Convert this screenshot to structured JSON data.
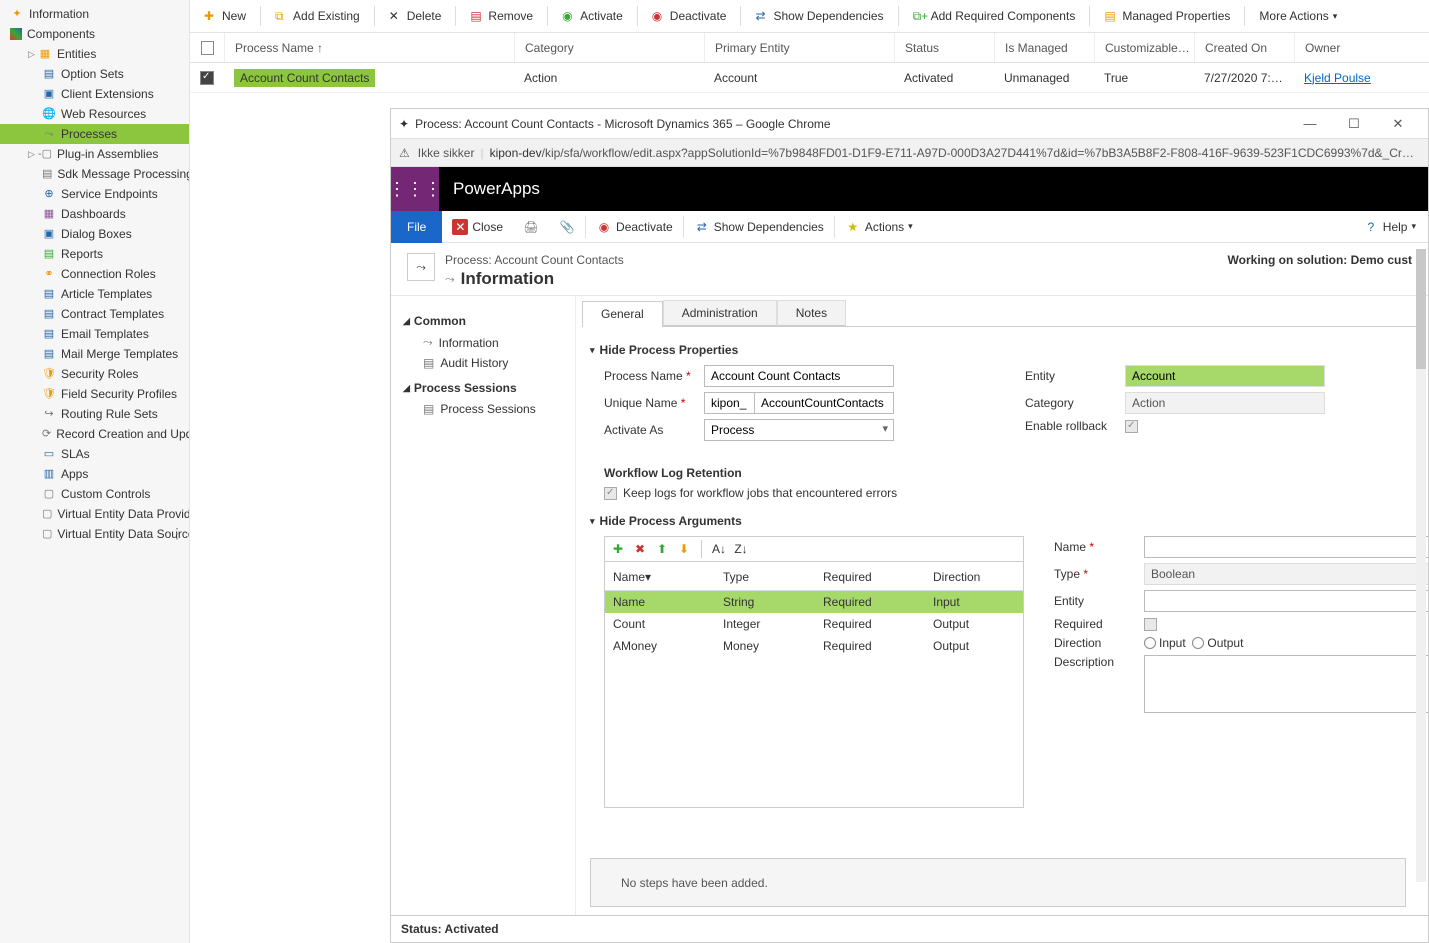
{
  "nav": {
    "information": "Information",
    "components": "Components",
    "entities": "Entities",
    "option_sets": "Option Sets",
    "client_ext": "Client Extensions",
    "web_res": "Web Resources",
    "processes": "Processes",
    "plugin": "Plug-in Assemblies",
    "sdk_msg": "Sdk Message Processing St…",
    "svc_endpoints": "Service Endpoints",
    "dashboards": "Dashboards",
    "dialog_boxes": "Dialog Boxes",
    "reports": "Reports",
    "conn_roles": "Connection Roles",
    "article_tpl": "Article Templates",
    "contract_tpl": "Contract Templates",
    "email_tpl": "Email Templates",
    "mailmerge_tpl": "Mail Merge Templates",
    "security_roles": "Security Roles",
    "field_sec": "Field Security Profiles",
    "routing": "Routing Rule Sets",
    "record_creation": "Record Creation and Upda…",
    "slas": "SLAs",
    "apps": "Apps",
    "custom_ctrl": "Custom Controls",
    "ve_providers": "Virtual Entity Data Providers",
    "ve_sources": "Virtual Entity Data Sources"
  },
  "toolbar": {
    "new": "New",
    "add_existing": "Add Existing",
    "delete": "Delete",
    "remove": "Remove",
    "activate": "Activate",
    "deactivate": "Deactivate",
    "show_dep": "Show Dependencies",
    "add_req": "Add Required Components",
    "managed": "Managed Properties",
    "more": "More Actions"
  },
  "grid": {
    "col_process": "Process Name ↑",
    "col_category": "Category",
    "col_entity": "Primary Entity",
    "col_status": "Status",
    "col_managed": "Is Managed",
    "col_custom": "Customizable…",
    "col_created": "Created On",
    "col_owner": "Owner",
    "row": {
      "name": "Account Count Contacts",
      "category": "Action",
      "entity": "Account",
      "status": "Activated",
      "managed": "Unmanaged",
      "custom": "True",
      "created": "7/27/2020 7:…",
      "owner": "Kjeld Poulse"
    }
  },
  "popup": {
    "title": "Process: Account Count Contacts - Microsoft Dynamics 365 – Google Chrome",
    "insecure": "Ikke sikker",
    "url_host": "kipon-dev",
    "url_path": "/kip/sfa/workflow/edit.aspx?appSolutionId=%7b9848FD01-D1F9-E711-A97D-000D3A27D441%7d&id=%7bB3A5B8F2-F808-416F-9639-523F1CDC6993%7d&_Cr…",
    "brand": "PowerApps",
    "file": "File",
    "close": "Close",
    "deactivate": "Deactivate",
    "show_dep": "Show Dependencies",
    "actions": "Actions",
    "help": "Help",
    "crumb": "Process: Account Count Contacts",
    "info": "Information",
    "solution": "Working on solution: Demo cust",
    "nav_common": "Common",
    "nav_info": "Information",
    "nav_audit": "Audit History",
    "nav_sessions_g": "Process Sessions",
    "nav_sessions": "Process Sessions"
  },
  "tabs": {
    "general": "General",
    "admin": "Administration",
    "notes": "Notes"
  },
  "props": {
    "section": "Hide Process Properties",
    "process_name_l": "Process Name",
    "process_name_v": "Account Count Contacts",
    "unique_name_l": "Unique Name",
    "unique_prefix": "kipon_",
    "unique_name_v": "AccountCountContacts",
    "activate_as_l": "Activate As",
    "activate_as_v": "Process",
    "entity_l": "Entity",
    "entity_v": "Account",
    "category_l": "Category",
    "category_v": "Action",
    "rollback_l": "Enable rollback",
    "log_head": "Workflow Log Retention",
    "log_desc": "Keep logs for workflow jobs that encountered errors"
  },
  "args": {
    "section": "Hide Process Arguments",
    "col_name": "Name▾",
    "col_type": "Type",
    "col_req": "Required",
    "col_dir": "Direction",
    "rows": [
      {
        "name": "Name",
        "type": "String",
        "req": "Required",
        "dir": "Input",
        "sel": true
      },
      {
        "name": "Count",
        "type": "Integer",
        "req": "Required",
        "dir": "Output",
        "sel": false
      },
      {
        "name": "AMoney",
        "type": "Money",
        "req": "Required",
        "dir": "Output",
        "sel": false
      }
    ],
    "f_name": "Name",
    "f_type": "Type",
    "f_entity": "Entity",
    "f_req": "Required",
    "f_dir": "Direction",
    "f_desc": "Description",
    "type_v": "Boolean",
    "dir_input": "Input",
    "dir_output": "Output"
  },
  "steps": {
    "none": "No steps have been added."
  },
  "status": {
    "text": "Status: Activated"
  }
}
